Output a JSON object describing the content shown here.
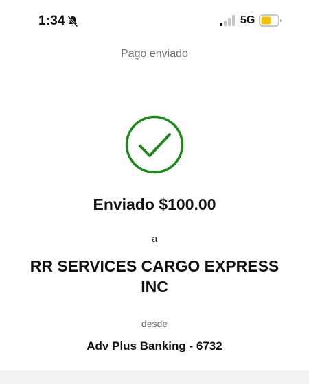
{
  "status_bar": {
    "time": "1:34",
    "network": "5G",
    "battery_color": "#f5c400"
  },
  "screen": {
    "title": "Pago enviado"
  },
  "confirmation": {
    "success_color": "#1e8a1e",
    "sent_amount": "Enviado $100.00",
    "to_label": "a",
    "recipient": "RR SERVICES CARGO EXPRESS INC",
    "from_label": "desde",
    "account": "Adv Plus Banking - 6732"
  }
}
